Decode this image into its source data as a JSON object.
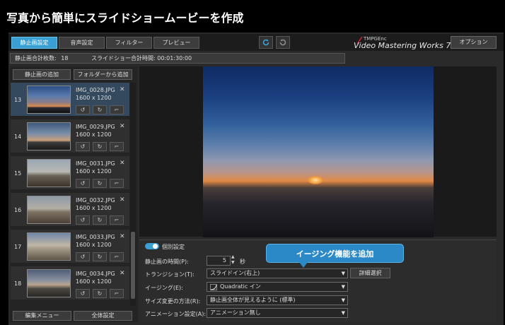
{
  "header_title": "写真から簡単にスライドショームービーを作成",
  "tabs": [
    {
      "label": "静止画設定",
      "active": true
    },
    {
      "label": "音声設定"
    },
    {
      "label": "フィルター"
    },
    {
      "label": "プレビュー"
    }
  ],
  "toolbar": {
    "undo_icon": "undo-icon",
    "redo_icon": "redo-icon"
  },
  "logo": {
    "brand": "TMPGEnc",
    "product": "Video Mastering Works 7"
  },
  "option_label": "オプション",
  "info": {
    "total_label": "静止画合計枚数:",
    "total_value": "18",
    "time_label": "スライドショー合計時間:",
    "time_value": "00:01:30:00"
  },
  "left": {
    "add_still": "静止画の追加",
    "add_folder": "フォルダーから追加",
    "edit_menu": "編集メニュー",
    "settings_all": "全体設定"
  },
  "items": [
    {
      "num": "13",
      "file": "IMG_0028.JPG",
      "dims": "1600 x 1200",
      "selected": true
    },
    {
      "num": "14",
      "file": "IMG_0029.JPG",
      "dims": "1600 x 1200"
    },
    {
      "num": "15",
      "file": "IMG_0031.JPG",
      "dims": "1600 x 1200"
    },
    {
      "num": "16",
      "file": "IMG_0032.JPG",
      "dims": "1600 x 1200"
    },
    {
      "num": "17",
      "file": "IMG_0033.JPG",
      "dims": "1600 x 1200"
    },
    {
      "num": "18",
      "file": "IMG_0034.JPG",
      "dims": "1600 x 1200"
    }
  ],
  "settings": {
    "individual_label": "個別設定",
    "duration_label": "静止画の時間(P):",
    "duration_value": "5",
    "duration_unit": "秒",
    "transition_label": "トランジション(T):",
    "transition_value": "スライドイン(右上)",
    "detail_button": "詳細選択",
    "easing_label": "イージング(E):",
    "easing_value": "Quadratic イン",
    "resize_label": "サイズ変更の方法(R):",
    "resize_value": "静止画全体が見えるように (標準)",
    "anim_label": "アニメーション設定(A):",
    "anim_value": "アニメーション無し"
  },
  "callout": "イージング機能を追加",
  "colors": {
    "accent": "#3aa0d4",
    "callout": "#2b89c8",
    "selected_row": "#34495e"
  }
}
